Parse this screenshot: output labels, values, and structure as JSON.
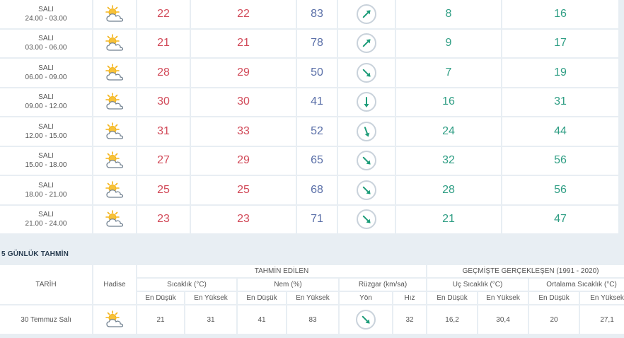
{
  "hourly": [
    {
      "day": "SALI",
      "time": "24.00 - 03.00",
      "temp": "22",
      "feels": "22",
      "humidity": "83",
      "wind_dir_deg": 45,
      "wind_speed": "8",
      "gust": "16"
    },
    {
      "day": "SALI",
      "time": "03.00 - 06.00",
      "temp": "21",
      "feels": "21",
      "humidity": "78",
      "wind_dir_deg": 45,
      "wind_speed": "9",
      "gust": "17"
    },
    {
      "day": "SALI",
      "time": "06.00 - 09.00",
      "temp": "28",
      "feels": "29",
      "humidity": "50",
      "wind_dir_deg": 135,
      "wind_speed": "7",
      "gust": "19"
    },
    {
      "day": "SALI",
      "time": "09.00 - 12.00",
      "temp": "30",
      "feels": "30",
      "humidity": "41",
      "wind_dir_deg": 180,
      "wind_speed": "16",
      "gust": "31"
    },
    {
      "day": "SALI",
      "time": "12.00 - 15.00",
      "temp": "31",
      "feels": "33",
      "humidity": "52",
      "wind_dir_deg": 160,
      "wind_speed": "24",
      "gust": "44"
    },
    {
      "day": "SALI",
      "time": "15.00 - 18.00",
      "temp": "27",
      "feels": "29",
      "humidity": "65",
      "wind_dir_deg": 135,
      "wind_speed": "32",
      "gust": "56"
    },
    {
      "day": "SALI",
      "time": "18.00 - 21.00",
      "temp": "25",
      "feels": "25",
      "humidity": "68",
      "wind_dir_deg": 135,
      "wind_speed": "28",
      "gust": "56"
    },
    {
      "day": "SALI",
      "time": "21.00 - 24.00",
      "temp": "23",
      "feels": "23",
      "humidity": "71",
      "wind_dir_deg": 135,
      "wind_speed": "21",
      "gust": "47"
    }
  ],
  "five_day": {
    "title": "5 GÜNLÜK TAHMİN",
    "headers": {
      "tarih": "TARİH",
      "hadise": "Hadise",
      "tahmin": "TAHMİN EDİLEN",
      "gecmis": "GEÇMİŞTE GERÇEKLEŞEN (1991 - 2020)",
      "sicaklik": "Sıcaklık (°C)",
      "nem": "Nem (%)",
      "ruzgar": "Rüzgar (km/sa)",
      "uc_sicaklik": "Uç Sıcaklık (°C)",
      "ort_sicaklik": "Ortalama Sıcaklık (°C)",
      "en_dusuk": "En Düşük",
      "en_yuksek": "En Yüksek",
      "yon": "Yön",
      "hiz": "Hız"
    },
    "rows": [
      {
        "date": "30 Temmuz Salı",
        "temp_min": "21",
        "temp_max": "31",
        "hum_min": "41",
        "hum_max": "83",
        "wind_dir_deg": 135,
        "wind_speed": "32",
        "extreme_min": "16,2",
        "extreme_max": "30,4",
        "avg_min": "20",
        "avg_max": "27,1"
      }
    ]
  },
  "icons": {
    "weather": "partly-cloudy-icon",
    "wind": "wind-direction-arrow-icon"
  },
  "colors": {
    "temp": "#d24b5a",
    "humidity": "#5a6fa8",
    "wind": "#2f9e84",
    "arrow": "#1f9d7a"
  }
}
